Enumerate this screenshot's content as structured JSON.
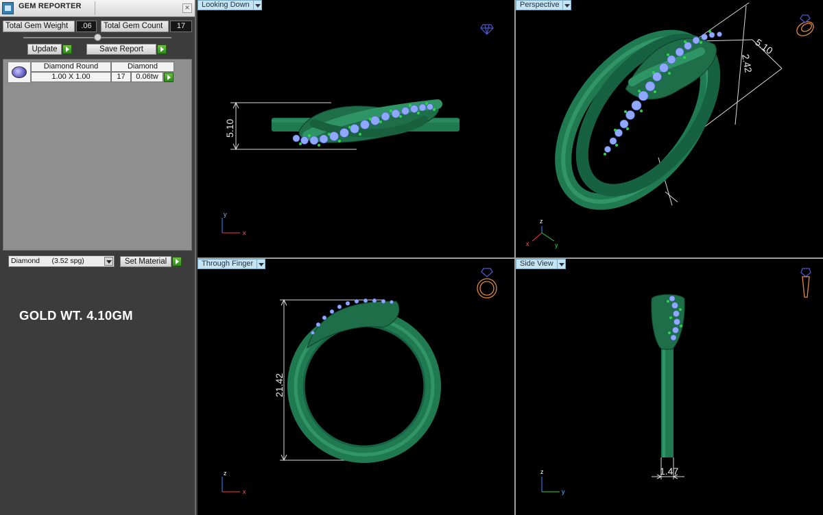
{
  "panel": {
    "title": "GEM REPORTER",
    "close_symbol": "×",
    "total_gem_weight_label": "Total Gem Weight",
    "total_gem_weight_value": ".06",
    "total_gem_count_label": "Total Gem Count",
    "total_gem_count_value": "17",
    "update_label": "Update",
    "save_report_label": "Save Report",
    "gem_table": {
      "headers": [
        "Diamond Round",
        "Diamond"
      ],
      "row": {
        "size": "1.00 X 1.00",
        "count": "17",
        "weight": "0.06tw"
      }
    },
    "material_select": "Diamond      (3.52 spg)",
    "set_material_label": "Set Material",
    "gold_weight_text": "GOLD WT. 4.10GM"
  },
  "viewports": {
    "top_left": {
      "label": "Looking Down",
      "dimension": "5.10",
      "axis_up": "y",
      "axis_right": "x",
      "icon": "diamond-icon"
    },
    "top_right": {
      "label": "Perspective",
      "dimension": "5.10",
      "dimension_small": "2.42",
      "axis_up": "z",
      "axis_left": "x",
      "axis_right": "y",
      "icon": "ring-perspective-icon"
    },
    "bottom_left": {
      "label": "Through Finger",
      "dimension": "21.42",
      "axis_up": "z",
      "axis_right": "x",
      "icon": "ring-front-icon"
    },
    "bottom_right": {
      "label": "Side View",
      "dimension": "1.47",
      "axis_up": "z",
      "axis_right": "y",
      "icon": "ring-side-icon"
    }
  },
  "colors": {
    "metal": "#1f7a52",
    "metal_light": "#3fa776",
    "stone": "#8fa7ff",
    "prong": "#2fd34a",
    "icon_orange": "#e08a3c",
    "icon_blue": "#4b56c8",
    "viewport_bg": "#000000",
    "viewport_label_bg": "#c5e3f1"
  }
}
